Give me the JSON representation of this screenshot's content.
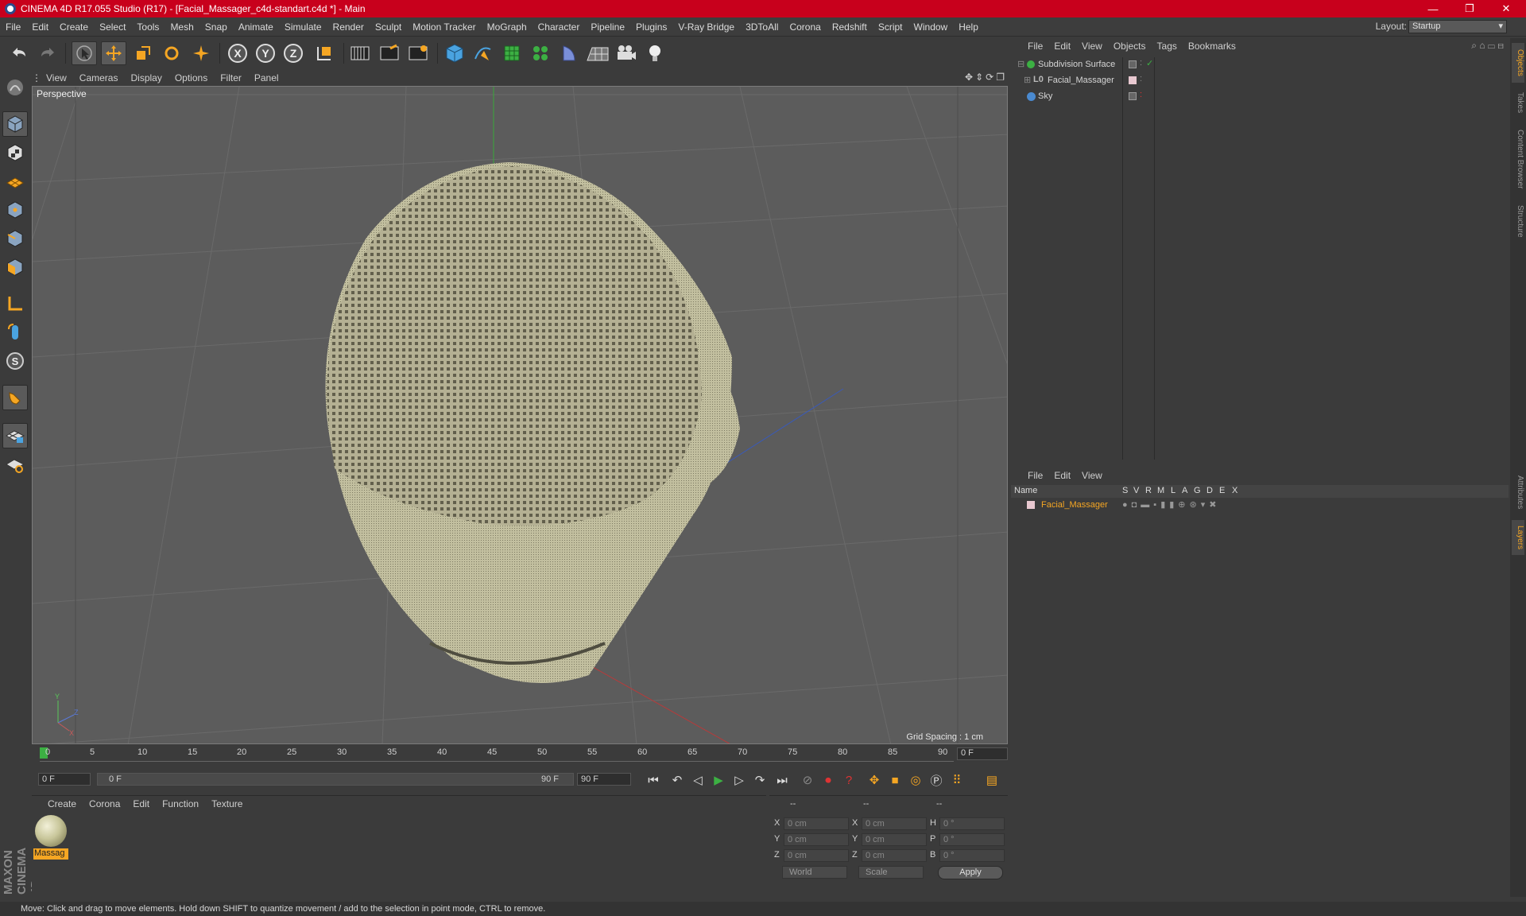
{
  "window": {
    "title": "CINEMA 4D R17.055 Studio (R17) - [Facial_Massager_c4d-standart.c4d *] - Main",
    "minimize": "—",
    "maximize": "❐",
    "close": "✕"
  },
  "menubar": [
    "File",
    "Edit",
    "Create",
    "Select",
    "Tools",
    "Mesh",
    "Snap",
    "Animate",
    "Simulate",
    "Render",
    "Sculpt",
    "Motion Tracker",
    "MoGraph",
    "Character",
    "Pipeline",
    "Plugins",
    "V-Ray Bridge",
    "3DToAll",
    "Corona",
    "Redshift",
    "Script",
    "Window",
    "Help"
  ],
  "layout": {
    "label": "Layout:",
    "value": "Startup"
  },
  "toolbar": {
    "icons": [
      "undo-icon",
      "redo-icon",
      "select-arrow-icon",
      "move-icon",
      "scale-icon",
      "rotate-icon",
      "last-tool-icon",
      "x-axis-icon",
      "y-axis-icon",
      "z-axis-icon",
      "world-coord-icon",
      "render-view-icon",
      "render-picture-viewer-icon",
      "edit-render-settings-icon",
      "cube-icon",
      "pen-spline-icon",
      "subdivision-icon",
      "cloner-icon",
      "deformer-icon",
      "floor-icon",
      "camera-icon",
      "light-icon"
    ],
    "x_label": "X",
    "y_label": "Y",
    "z_label": "Z"
  },
  "left_tools": [
    "make-editable-icon",
    "model-mode-icon",
    "texture-mode-icon",
    "workplane-icon",
    "points-mode-icon",
    "edges-mode-icon",
    "polygons-mode-icon",
    "axis-mode-icon",
    "tweak-icon",
    "snap-icon",
    "magnet-icon",
    "lock-workplane-icon",
    "workplane-grid-icon"
  ],
  "brand": "MAXON CINEMA 4D",
  "viewport": {
    "menu": [
      "View",
      "Cameras",
      "Display",
      "Options",
      "Filter",
      "Panel"
    ],
    "label": "Perspective",
    "grid_spacing": "Grid Spacing : 1 cm"
  },
  "timeline": {
    "ticks": [
      "0",
      "5",
      "10",
      "15",
      "20",
      "25",
      "30",
      "35",
      "40",
      "45",
      "50",
      "55",
      "60",
      "65",
      "70",
      "75",
      "80",
      "85",
      "90"
    ],
    "current": "0 F"
  },
  "transport": {
    "start": "0 F",
    "range_start": "0 F",
    "range_end": "90 F",
    "end": "90 F"
  },
  "material_panel": {
    "menu": [
      "Create",
      "Corona",
      "Edit",
      "Function",
      "Texture"
    ],
    "materials": [
      {
        "name": "Massag"
      }
    ]
  },
  "coords": {
    "headers": [
      "--",
      "--",
      "--"
    ],
    "rows": [
      {
        "a": "X",
        "pos": "0 cm",
        "b": "X",
        "size": "0 cm",
        "c": "H",
        "rot": "0 °"
      },
      {
        "a": "Y",
        "pos": "0 cm",
        "b": "Y",
        "size": "0 cm",
        "c": "P",
        "rot": "0 °"
      },
      {
        "a": "Z",
        "pos": "0 cm",
        "b": "Z",
        "size": "0 cm",
        "c": "B",
        "rot": "0 °"
      }
    ],
    "mode1": "World",
    "mode2": "Scale",
    "apply": "Apply"
  },
  "object_manager": {
    "menu": [
      "File",
      "Edit",
      "View",
      "Objects",
      "Tags",
      "Bookmarks"
    ],
    "objects": [
      {
        "name": "Subdivision Surface"
      },
      {
        "name": "Facial_Massager"
      },
      {
        "name": "Sky"
      }
    ]
  },
  "layer_manager": {
    "menu": [
      "File",
      "Edit",
      "View"
    ],
    "columns": [
      "Name",
      "S",
      "V",
      "R",
      "M",
      "L",
      "A",
      "G",
      "D",
      "E",
      "X"
    ],
    "layers": [
      {
        "name": "Facial_Massager"
      }
    ]
  },
  "side_tabs": [
    "Objects",
    "Takes",
    "Content Browser",
    "Structure",
    "Attributes",
    "Layers"
  ],
  "status": "Move: Click and drag to move elements. Hold down SHIFT to quantize movement / add to the selection in point mode, CTRL to remove."
}
